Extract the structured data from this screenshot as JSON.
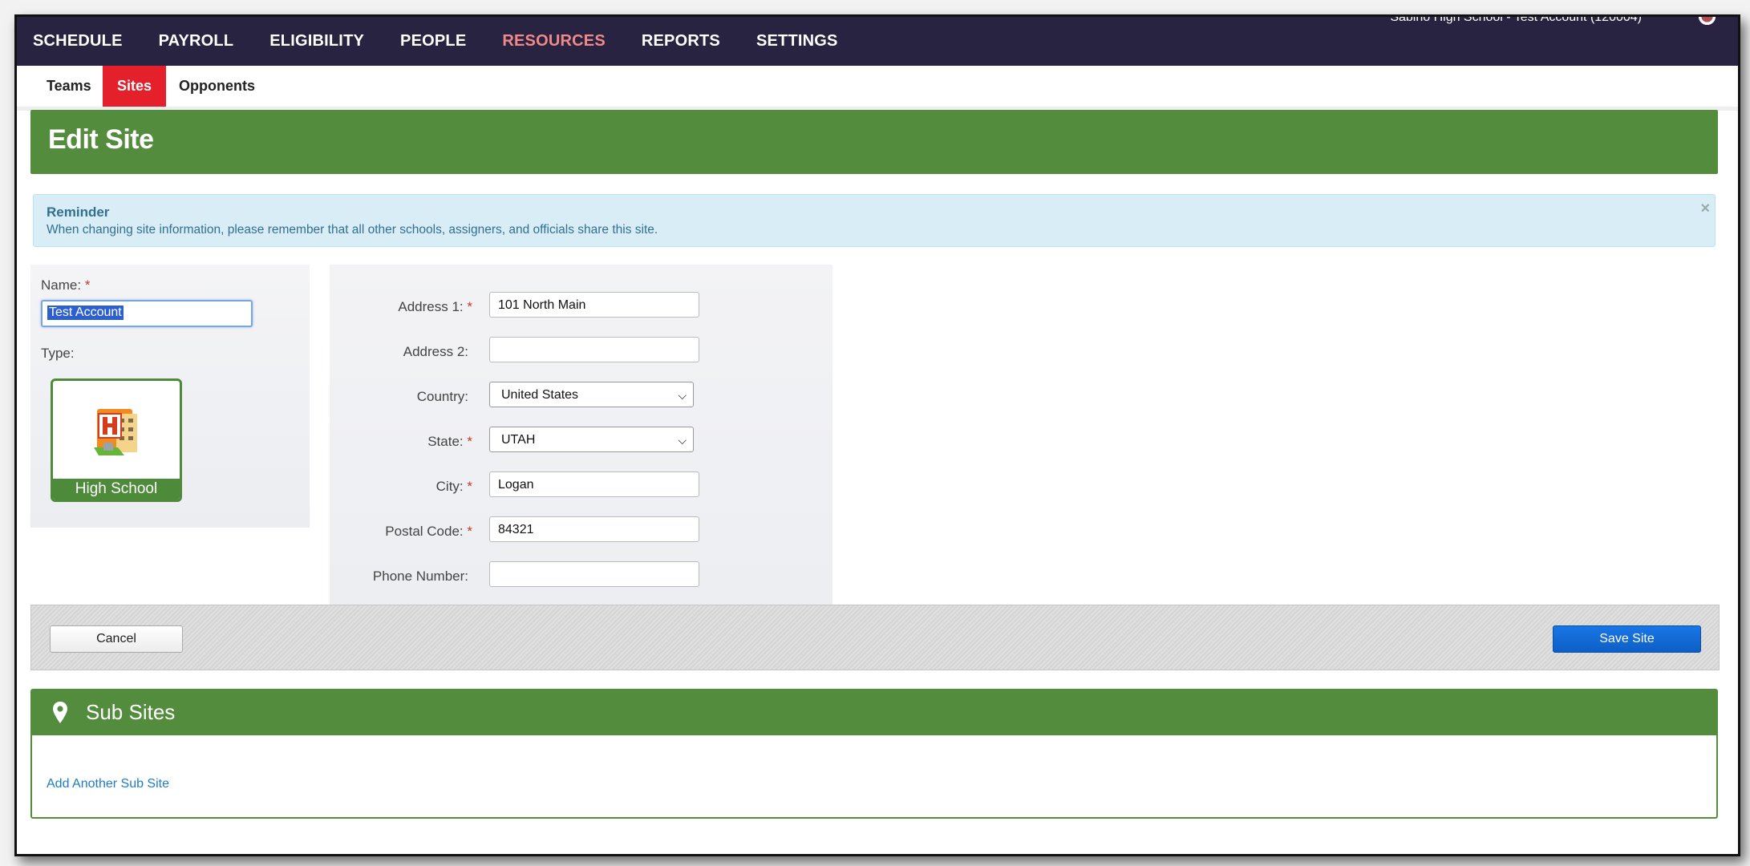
{
  "topnav": {
    "items": [
      "SCHEDULE",
      "PAYROLL",
      "ELIGIBILITY",
      "PEOPLE",
      "RESOURCES",
      "REPORTS",
      "SETTINGS"
    ],
    "active": "RESOURCES",
    "account_label": "Sabino High School - Test Account (120004)"
  },
  "subnav": {
    "tabs": [
      "Teams",
      "Sites",
      "Opponents"
    ],
    "active": "Sites"
  },
  "page": {
    "title": "Edit Site"
  },
  "alert": {
    "title": "Reminder",
    "message": "When changing site information, please remember that all other schools, assigners, and officials share this site.",
    "close_glyph": "×"
  },
  "form": {
    "name_label": "Name:",
    "name_value": "Test Account",
    "required_mark": "*",
    "type_label": "Type:",
    "type_value": "High School",
    "fields": {
      "address1": {
        "label": "Address 1:",
        "value": "101 North Main",
        "required": true
      },
      "address2": {
        "label": "Address 2:",
        "value": "",
        "required": false
      },
      "country": {
        "label": "Country:",
        "value": "United States",
        "required": false
      },
      "state": {
        "label": "State:",
        "value": "UTAH",
        "required": true
      },
      "city": {
        "label": "City:",
        "value": "Logan",
        "required": true
      },
      "postal": {
        "label": "Postal Code:",
        "value": "84321",
        "required": true
      },
      "phone": {
        "label": "Phone Number:",
        "value": "",
        "required": false
      }
    }
  },
  "actions": {
    "cancel_label": "Cancel",
    "save_label": "Save Site"
  },
  "subsites": {
    "title": "Sub Sites",
    "add_link": "Add Another Sub Site"
  },
  "colors": {
    "nav_bg": "#272340",
    "accent_red": "#e4202b",
    "header_green": "#548c3e",
    "save_blue": "#1976e6",
    "alert_bg": "#d9edf7"
  }
}
